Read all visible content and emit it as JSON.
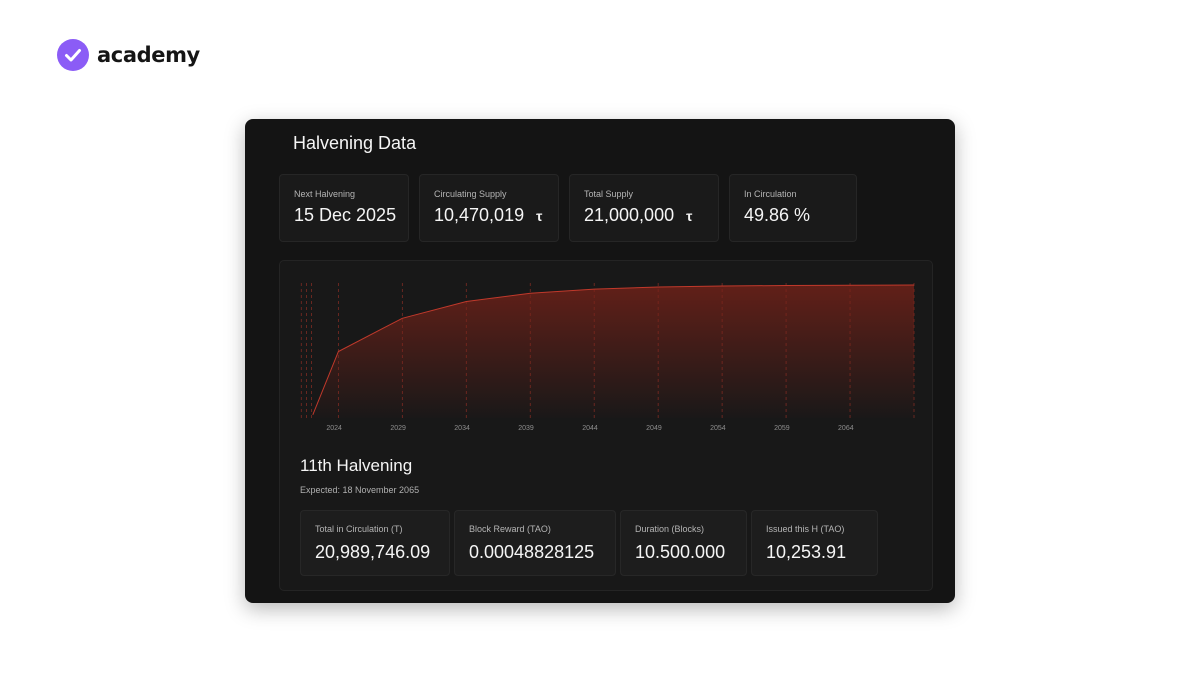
{
  "brand": {
    "name": "academy",
    "accent": "#8b5cf6"
  },
  "panel": {
    "title": "Halvening Data"
  },
  "stats": [
    {
      "label": "Next Halvening",
      "value": "15 Dec 2025",
      "unit": ""
    },
    {
      "label": "Circulating Supply",
      "value": "10,470,019",
      "unit": "τ"
    },
    {
      "label": "Total Supply",
      "value": "21,000,000",
      "unit": "τ"
    },
    {
      "label": "In Circulation",
      "value": "49.86 %",
      "unit": ""
    }
  ],
  "chart_data": {
    "type": "area",
    "x": [
      2022.0,
      2024.0,
      2029.0,
      2034.0,
      2039.0,
      2044.0,
      2049.0,
      2054.0,
      2059.0,
      2064.0,
      2069.0
    ],
    "values": [
      0.5,
      10.5,
      15.75,
      18.4,
      19.7,
      20.35,
      20.68,
      20.84,
      20.92,
      20.96,
      21.0
    ],
    "ylim": [
      0,
      21
    ],
    "xlim": [
      2021.0,
      2069.0
    ],
    "x_ticks": [
      "2024",
      "2029",
      "2034",
      "2039",
      "2044",
      "2049",
      "2054",
      "2059",
      "2064"
    ],
    "x_tick_values": [
      2024,
      2029,
      2034,
      2039,
      2044,
      2049,
      2054,
      2059,
      2064
    ],
    "halvening_lines": [
      2021.1,
      2021.5,
      2021.9,
      2024.0,
      2029.0,
      2034.0,
      2039.0,
      2044.0,
      2049.0,
      2054.0,
      2059.0,
      2064.0,
      2069.0
    ],
    "line_color": "#c0392b",
    "fill_color": "#7a2218",
    "grid": false,
    "xlabel": "",
    "ylabel": ""
  },
  "halvening": {
    "title": "11th Halvening",
    "expected": "Expected: 18 November 2065",
    "details": [
      {
        "label": "Total in Circulation (T)",
        "value": "20,989,746.09"
      },
      {
        "label": "Block Reward (TAO)",
        "value": "0.00048828125"
      },
      {
        "label": "Duration (Blocks)",
        "value": "10.500.000"
      },
      {
        "label": "Issued this H (TAO)",
        "value": "10,253.91"
      }
    ]
  }
}
